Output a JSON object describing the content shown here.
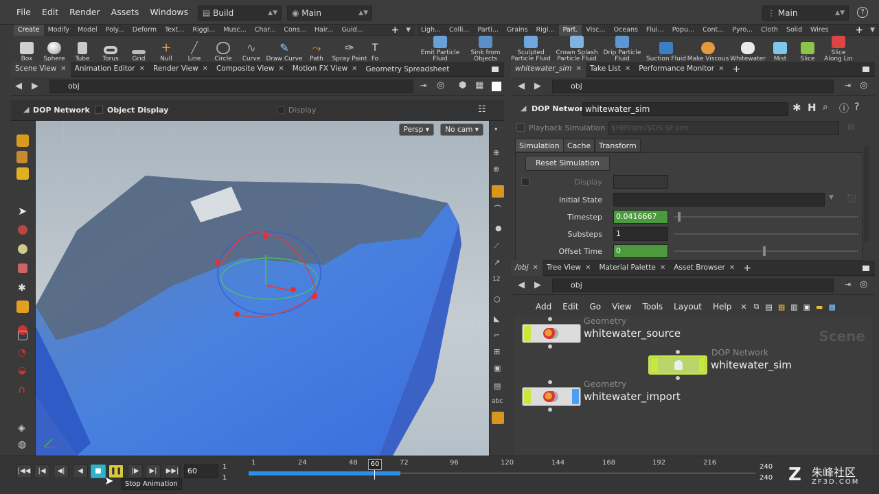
{
  "menubar": {
    "items": [
      "File",
      "Edit",
      "Render",
      "Assets",
      "Windows",
      "Help"
    ],
    "desktop": "Build",
    "context": "Main",
    "right_desktop": "Main"
  },
  "shelf_left": {
    "tabs": [
      "Create",
      "Modify",
      "Model",
      "Poly...",
      "Deform",
      "Text...",
      "Riggi...",
      "Musc...",
      "Char...",
      "Cons...",
      "Hair...",
      "Guid..."
    ],
    "tools": [
      "Box",
      "Sphere",
      "Tube",
      "Torus",
      "Grid",
      "Null",
      "Line",
      "Circle",
      "Curve",
      "Draw Curve",
      "Path",
      "Spray Paint",
      "Fo"
    ]
  },
  "shelf_right": {
    "tabs": [
      "Ligh...",
      "Colli...",
      "Parti...",
      "Grains",
      "Rigi...",
      "Part.",
      "Visc...",
      "Oceans",
      "Flui...",
      "Popu...",
      "Cont...",
      "Pyro...",
      "Cloth",
      "Solid",
      "Wires"
    ],
    "tools": [
      "Emit Particle Fluid",
      "Sink from Objects",
      "Sculpted Particle Fluid",
      "Crown Splash Particle Fluid",
      "Drip Particle Fluid",
      "Suction Fluid",
      "Make Viscous",
      "Whitewater",
      "Mist",
      "Slice",
      "Slice Along Lin"
    ]
  },
  "left_pane": {
    "tabs": [
      "Scene View",
      "Animation Editor",
      "Render View",
      "Composite View",
      "Motion FX View",
      "Geometry Spreadsheet"
    ],
    "path": "obj",
    "network_label": "DOP Network",
    "object_display": "Object Display",
    "display": "Display",
    "persp": "Persp ▾",
    "cam": "No cam ▾"
  },
  "param_pane": {
    "tabs": [
      "whitewater_sim",
      "Take List",
      "Performance Monitor"
    ],
    "path": "obj",
    "type": "DOP Network",
    "node_name": "whitewater_sim",
    "playback": "Playback Simulation",
    "playback_path": "$HIP/sim/$OS.$F.sim",
    "subtabs": [
      "Simulation",
      "Cache",
      "Transform"
    ],
    "reset_button": "Reset Simulation",
    "params": [
      {
        "label": "Display",
        "value": ""
      },
      {
        "label": "Initial State",
        "value": ""
      },
      {
        "label": "Timestep",
        "value": "0.0416667"
      },
      {
        "label": "Substeps",
        "value": "1"
      },
      {
        "label": "Offset Time",
        "value": "0"
      }
    ]
  },
  "network_pane": {
    "tabs": [
      "/obj",
      "Tree View",
      "Material Palette",
      "Asset Browser"
    ],
    "path": "obj",
    "menu": [
      "Add",
      "Edit",
      "Go",
      "View",
      "Tools",
      "Layout",
      "Help"
    ],
    "watermark": "Scene",
    "nodes": [
      {
        "type": "Geometry",
        "name": "whitewater_source"
      },
      {
        "type": "DOP Network",
        "name": "whitewater_sim"
      },
      {
        "type": "Geometry",
        "name": "whitewater_import"
      }
    ]
  },
  "timeline": {
    "current_frame": "60",
    "start": "1",
    "start2": "1",
    "end": "240",
    "end2": "240",
    "marker": "60",
    "ticks": [
      "1",
      "24",
      "48",
      "72",
      "96",
      "120",
      "144",
      "168",
      "192",
      "216"
    ],
    "tooltip": "Stop Animation",
    "cached_fraction": 0.3
  },
  "watermark": {
    "text": "朱峰社区",
    "sub": "ZF3D.COM"
  }
}
